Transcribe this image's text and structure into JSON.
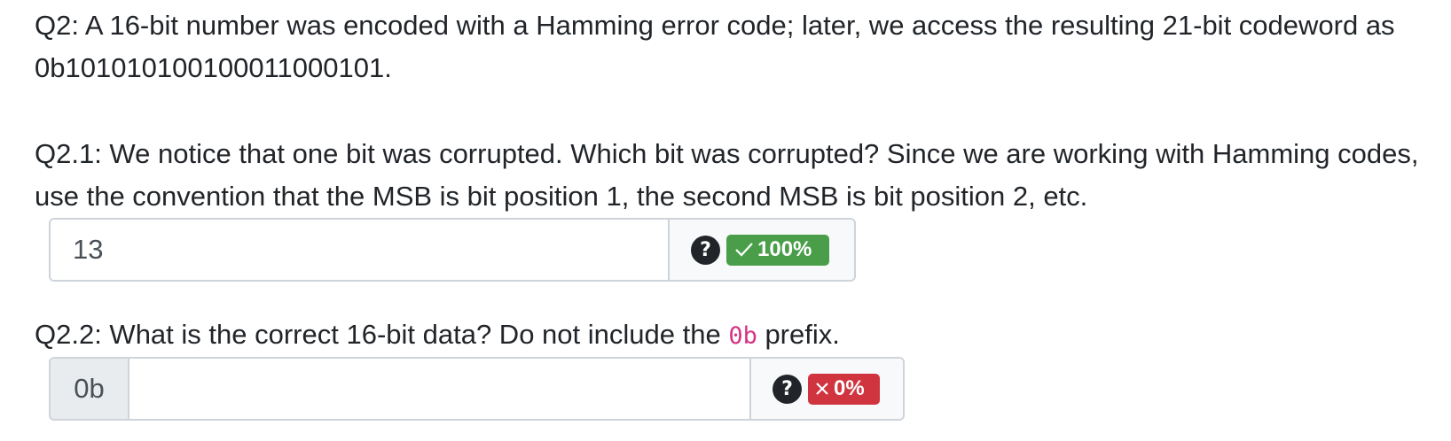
{
  "q2": {
    "text": "Q2: A 16-bit number was encoded with a Hamming error code; later, we access the resulting 21-bit codeword as 0b101010100100011000101."
  },
  "q2_1": {
    "text": "Q2.1: We notice that one bit was corrupted. Which bit was corrupted? Since we are working with Hamming codes, use the convention that the MSB is bit position 1, the second MSB is bit position 2, etc.",
    "answer_value": "13",
    "help_label": "?",
    "score_label": "100%",
    "score_icon": "check-icon",
    "score_color": "#4a9e4a"
  },
  "q2_2": {
    "text_before": "Q2.2: What is the correct 16-bit data? Do not include the ",
    "code": "0b",
    "text_after": " prefix.",
    "prefix_label": "0b",
    "answer_value": "",
    "help_label": "?",
    "score_label": "0%",
    "score_icon": "cross-icon",
    "score_color": "#d0343f"
  }
}
